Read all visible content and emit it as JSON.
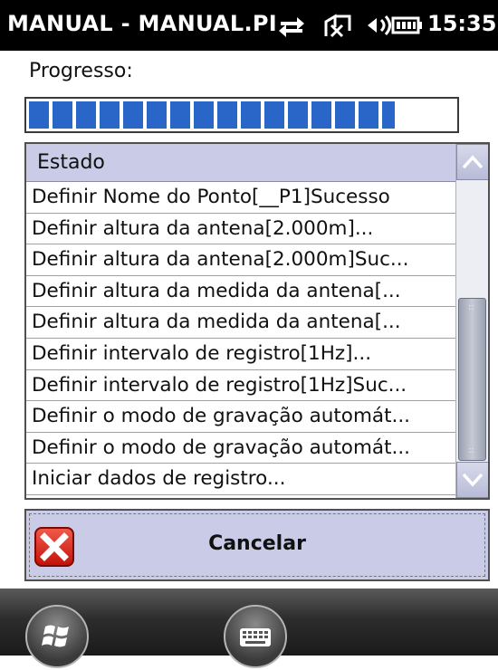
{
  "window": {
    "title": "MANUAL - MANUAL.PI",
    "clock": "15:35"
  },
  "progress": {
    "label": "Progresso:",
    "value_fraction": 0.86
  },
  "list": {
    "header": "Estado",
    "rows": [
      "Definir Nome do Ponto[__P1]Sucesso",
      "Definir altura da antena[2.000m]...",
      "Definir altura da antena[2.000m]Suc...",
      "Definir altura da medida da antena[...",
      "Definir altura da medida da antena[...",
      "Definir intervalo de registro[1Hz]...",
      "Definir intervalo de registro[1Hz]Suc...",
      "Definir o modo de gravação automát...",
      "Definir o modo de gravação automát...",
      "Iniciar dados de registro..."
    ]
  },
  "cancel": {
    "label": "Cancelar"
  },
  "icons": {
    "status": [
      "connectivity-icon",
      "signal-off-icon",
      "volume-icon",
      "battery-icon"
    ],
    "scroll_up": "chevron-up-icon",
    "scroll_down": "chevron-down-icon",
    "cancel": "close-icon",
    "start": "windows-start-icon",
    "keyboard": "keyboard-icon"
  },
  "colors": {
    "title_bg": "#000000",
    "progress_fill": "#2a65c8",
    "header_bg": "#c9cbe7",
    "cancel_icon": "#d9221a"
  }
}
